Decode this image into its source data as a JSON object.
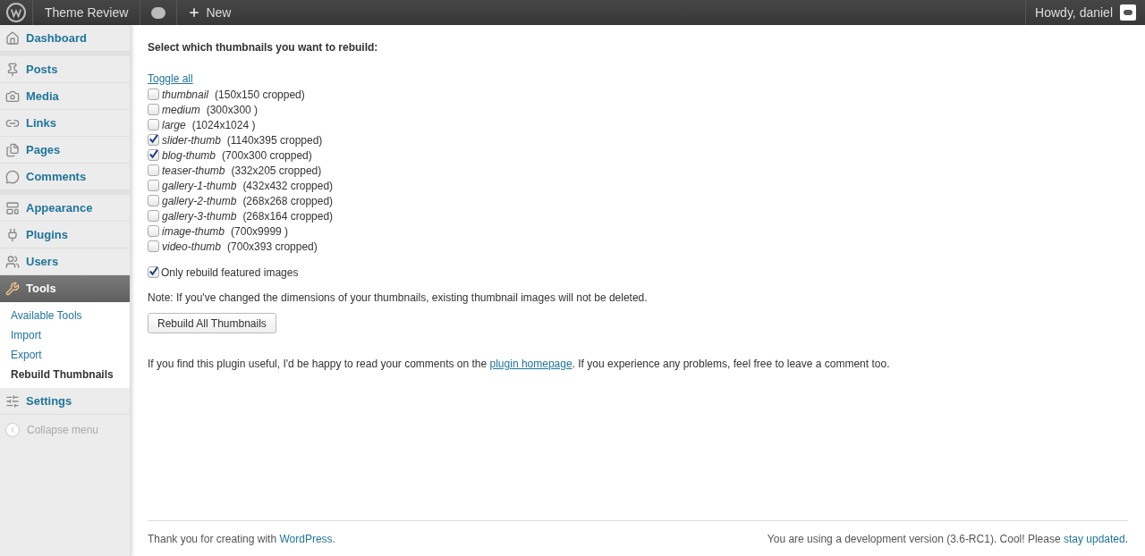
{
  "admin_bar": {
    "site": "Theme Review",
    "new": "New",
    "greeting": "Howdy, daniel"
  },
  "menu_groups": [
    [
      {
        "label": "Dashboard",
        "kind": "dashboard",
        "selected": false
      }
    ],
    [
      {
        "label": "Posts",
        "kind": "posts",
        "selected": false
      },
      {
        "label": "Media",
        "kind": "media",
        "selected": false
      },
      {
        "label": "Links",
        "kind": "links",
        "selected": false
      },
      {
        "label": "Pages",
        "kind": "pages",
        "selected": false
      },
      {
        "label": "Comments",
        "kind": "comments",
        "selected": false
      }
    ],
    [
      {
        "label": "Appearance",
        "kind": "appearance",
        "selected": false
      },
      {
        "label": "Plugins",
        "kind": "plugins",
        "selected": false
      },
      {
        "label": "Users",
        "kind": "users",
        "selected": false
      },
      {
        "label": "Tools",
        "kind": "tools",
        "selected": true,
        "children": [
          {
            "label": "Available Tools",
            "selected": false
          },
          {
            "label": "Import",
            "selected": false
          },
          {
            "label": "Export",
            "selected": false
          },
          {
            "label": "Rebuild Thumbnails",
            "selected": true
          }
        ]
      },
      {
        "label": "Settings",
        "kind": "settings",
        "selected": false
      }
    ]
  ],
  "collapse": "Collapse menu",
  "heading": "Select which thumbnails you want to rebuild:",
  "toggle_all": "Toggle all",
  "sizes": [
    {
      "name": "thumbnail",
      "dims": "(150x150 cropped)",
      "checked": false
    },
    {
      "name": "medium",
      "dims": "(300x300 )",
      "checked": false
    },
    {
      "name": "large",
      "dims": "(1024x1024 )",
      "checked": false
    },
    {
      "name": "slider-thumb",
      "dims": "(1140x395 cropped)",
      "checked": true
    },
    {
      "name": "blog-thumb",
      "dims": "(700x300 cropped)",
      "checked": true
    },
    {
      "name": "teaser-thumb",
      "dims": "(332x205 cropped)",
      "checked": false
    },
    {
      "name": "gallery-1-thumb",
      "dims": "(432x432 cropped)",
      "checked": false
    },
    {
      "name": "gallery-2-thumb",
      "dims": "(268x268 cropped)",
      "checked": false
    },
    {
      "name": "gallery-3-thumb",
      "dims": "(268x164 cropped)",
      "checked": false
    },
    {
      "name": "image-thumb",
      "dims": "(700x9999 )",
      "checked": false
    },
    {
      "name": "video-thumb",
      "dims": "(700x393 cropped)",
      "checked": false
    }
  ],
  "featured_only": {
    "label": "Only rebuild featured images",
    "checked": true
  },
  "note": "Note: If you've changed the dimensions of your thumbnails, existing thumbnail images will not be deleted.",
  "button": "Rebuild All Thumbnails",
  "info": {
    "before": "If you find this plugin useful, I'd be happy to read your comments on the",
    "link": "plugin homepage",
    "after": ". If you experience any problems, feel free to leave a comment too."
  },
  "footer": {
    "left_text": "Thank you for creating with",
    "left_link": "WordPress",
    "left_end": ".",
    "right_text": "You are using a development version (3.6-RC1). Cool! Please",
    "right_link": "stay updated",
    "right_end": "."
  }
}
